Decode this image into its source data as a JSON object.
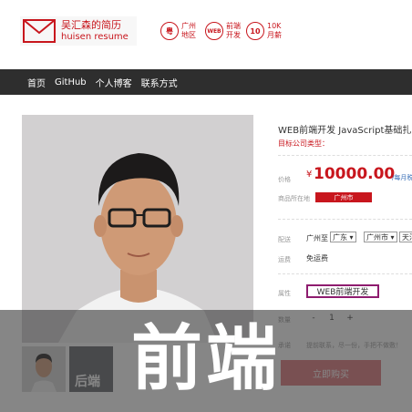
{
  "header": {
    "logo_cn": "吴汇森的简历",
    "logo_en": "huisen resume",
    "features": [
      {
        "icon": "location-icon",
        "badge": "粤",
        "line1": "广州",
        "line2": "地区"
      },
      {
        "icon": "web-icon",
        "badge": "WEB",
        "line1": "前端",
        "line2": "开发"
      },
      {
        "icon": "salary-icon",
        "badge": "10",
        "line1": "10K",
        "line2": "月薪"
      }
    ]
  },
  "nav": {
    "items": [
      "首页",
      "GitHub",
      "个人博客",
      "联系方式"
    ]
  },
  "thumbs": {
    "second_label": "后端"
  },
  "product": {
    "title": "WEB前端开发 JavaScript基础扎实 熟",
    "subtitle": "目标公司类型：",
    "price_label": "价格",
    "price_symbol": "¥",
    "price": "10000.00",
    "price_unit": "/每月税",
    "location_label": "商品所在地",
    "location": "广州市",
    "delivery_label": "配送",
    "ship_from": "广州",
    "ship_to": "至",
    "province": "广东 ▾",
    "city": "广州市 ▾",
    "district": "天河",
    "fee_label": "运费",
    "fee": "免运费",
    "attr_label": "属性",
    "attr": "WEB前端开发",
    "qty_label": "数量",
    "qty_minus": "-",
    "qty_value": "1",
    "qty_plus": "+",
    "note_label": "承诺",
    "note": "提前联系，尽一份，手把不做敷！",
    "buy_label": "立即购买"
  },
  "overlay": {
    "text": "前端"
  },
  "colors": {
    "brand": "#c8161d",
    "nav_bg": "#2e2e2e",
    "attr_border": "#8e1c6f"
  }
}
